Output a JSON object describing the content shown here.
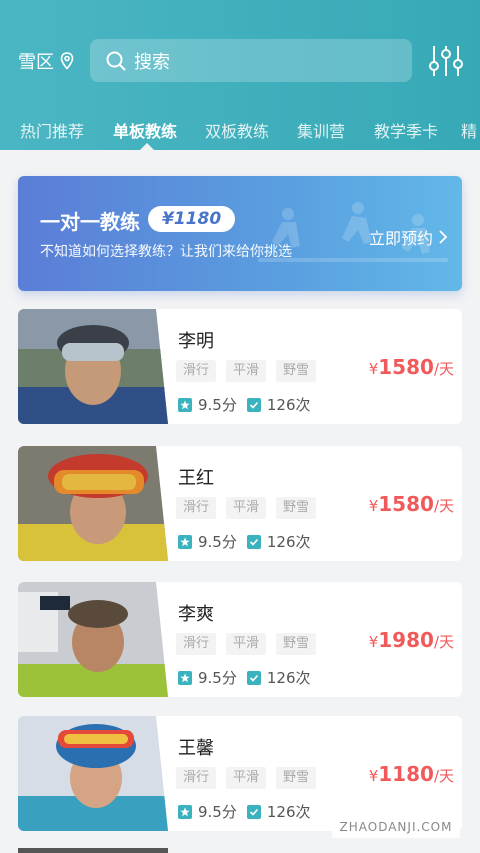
{
  "header": {
    "location": "雪区",
    "search_placeholder": "搜索",
    "tabs": [
      "热门推荐",
      "单板教练",
      "双板教练",
      "集训营",
      "教学季卡",
      "精"
    ],
    "active_tab_index": 1
  },
  "banner": {
    "title": "一对一教练",
    "price": "¥1180",
    "subtitle": "不知道如何选择教练？让我们来给你挑选",
    "cta": "立即预约"
  },
  "coaches": [
    {
      "name": "李明",
      "tags": [
        "滑行",
        "平滑",
        "野雪"
      ],
      "rating": "9.5分",
      "count": "126次",
      "currency": "¥",
      "price": "1580",
      "unit": "/天"
    },
    {
      "name": "王红",
      "tags": [
        "滑行",
        "平滑",
        "野雪"
      ],
      "rating": "9.5分",
      "count": "126次",
      "currency": "¥",
      "price": "1580",
      "unit": "/天"
    },
    {
      "name": "李爽",
      "tags": [
        "滑行",
        "平滑",
        "野雪"
      ],
      "rating": "9.5分",
      "count": "126次",
      "currency": "¥",
      "price": "1980",
      "unit": "/天"
    },
    {
      "name": "王馨",
      "tags": [
        "滑行",
        "平滑",
        "野雪"
      ],
      "rating": "9.5分",
      "count": "126次",
      "currency": "¥",
      "price": "1180",
      "unit": "/天"
    }
  ],
  "watermark": "ZHAODANJI.COM",
  "colors": {
    "accent": "#3bb3be",
    "price": "#f15a5a",
    "banner": "#5a8fdc"
  }
}
